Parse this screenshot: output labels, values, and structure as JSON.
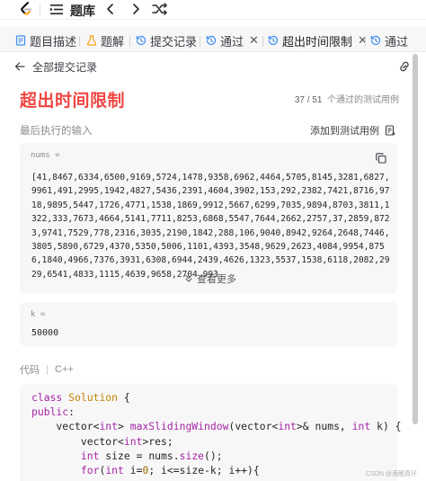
{
  "topbar": {
    "title": "题库"
  },
  "tabs": [
    {
      "label": "题目描述",
      "icon": "document-icon"
    },
    {
      "label": "题解",
      "icon": "flask-icon"
    },
    {
      "label": "提交记录",
      "icon": "history-icon"
    },
    {
      "label": "通过",
      "icon": "history-icon",
      "close": "✕"
    },
    {
      "label": "超出时间限制",
      "icon": "history-icon",
      "close": "✕"
    },
    {
      "label": "通过",
      "icon": "history-icon"
    }
  ],
  "back": {
    "label": "全部提交记录"
  },
  "result": {
    "title": "超出时间限制",
    "passed": "37 / 51",
    "passed_suffix": "个通过的测试用例"
  },
  "last_input": {
    "label": "最后执行的输入",
    "add_case": "添加到测试用例"
  },
  "nums": {
    "label": "nums =",
    "value": "[41,8467,6334,6500,9169,5724,1478,9358,6962,4464,5705,8145,3281,6827,9961,491,2995,1942,4827,5436,2391,4604,3902,153,292,2382,7421,8716,9718,9895,5447,1726,4771,1538,1869,9912,5667,6299,7035,9894,8703,3811,1322,333,7673,4664,5141,7711,8253,6868,5547,7644,2662,2757,37,2859,8723,9741,7529,778,2316,3035,2190,1842,288,106,9040,8942,9264,2648,7446,3805,5890,6729,4370,5350,5006,1101,4393,3548,9629,2623,4084,9954,8756,1840,4966,7376,3931,6308,6944,2439,4626,1323,5537,1538,6118,2082,2929,6541,4833,1115,4639,9658,2704,993",
    "view_more": "查看更多"
  },
  "k": {
    "label": "k =",
    "value": "50000"
  },
  "code_section": {
    "label": "代码",
    "language": "C++"
  },
  "code_lines": [
    "class Solution {",
    "public:",
    "    vector<int> maxSlidingWindow(vector<int>& nums, int k) {",
    "        vector<int>res;",
    "        int size = nums.size();",
    "        for(int i=0; i<=size-k; i++){"
  ],
  "watermark": "CSDN @酒醒真仔",
  "colors": {
    "error_red": "#ef4743",
    "panel_bg": "#f7f7f8",
    "keyword": "#a626a4",
    "type": "#0184bc"
  }
}
